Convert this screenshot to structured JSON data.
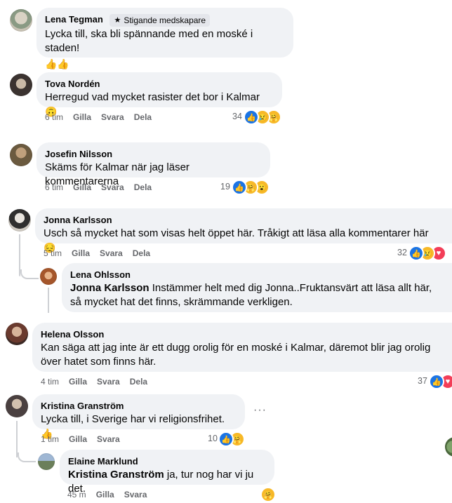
{
  "comments": [
    {
      "name": "Lena Tegman",
      "badge": "Stigande medskapare",
      "text": "Lycka till, ska bli spännande med en moské i staden!",
      "emoji": "👍👍"
    },
    {
      "name": "Tova Nordén",
      "text": "Herregud vad mycket rasister det bor i Kalmar",
      "emoji": "🙃",
      "time": "6 tim",
      "like": "Gilla",
      "reply": "Svara",
      "share": "Dela",
      "count": "34"
    },
    {
      "name": "Josefin Nilsson",
      "text": "Skäms för Kalmar när jag läser kommentarerna",
      "time": "6 tim",
      "like": "Gilla",
      "reply": "Svara",
      "share": "Dela",
      "count": "19"
    },
    {
      "name": "Jonna Karlsson",
      "text": "Usch så mycket hat som visas helt öppet här. Tråkigt att läsa alla kommentarer här",
      "emoji": "😔",
      "time": "5 tim",
      "like": "Gilla",
      "reply": "Svara",
      "share": "Dela",
      "count": "32"
    },
    {
      "name": "Lena Ohlsson",
      "mention": "Jonna Karlsson",
      "text": "Instämmer helt med dig Jonna..Fruktansvärt att läsa allt här, så mycket hat det finns, skrämmande verkligen."
    },
    {
      "name": "Helena Olsson",
      "text": "Kan säga att jag inte är ett dugg orolig för en moské i Kalmar, däremot blir jag orolig över hatet som finns här.",
      "time": "4 tim",
      "like": "Gilla",
      "reply": "Svara",
      "share": "Dela",
      "count": "37"
    },
    {
      "name": "Kristina Granström",
      "text": "Lycka till, i Sverige har vi religionsfrihet.",
      "emoji": "👍",
      "time": "1 tim",
      "like": "Gilla",
      "reply": "Svara",
      "count": "10",
      "more": "···"
    },
    {
      "name": "Elaine Marklund",
      "mention": "Kristina Granström",
      "text": "ja, tur nog har vi ju det.",
      "time": "45 m",
      "like": "Gilla",
      "reply": "Svara"
    }
  ],
  "icons": {
    "like": "thumbs-up-icon",
    "love": "heart-icon",
    "care": "care-emoji-icon",
    "sad": "sad-emoji-icon",
    "wow": "wow-emoji-icon",
    "star": "star-icon"
  },
  "colors": {
    "like": "#1b74e4",
    "love": "#f33e58",
    "bubble": "#f0f2f5",
    "meta": "#65676b"
  }
}
